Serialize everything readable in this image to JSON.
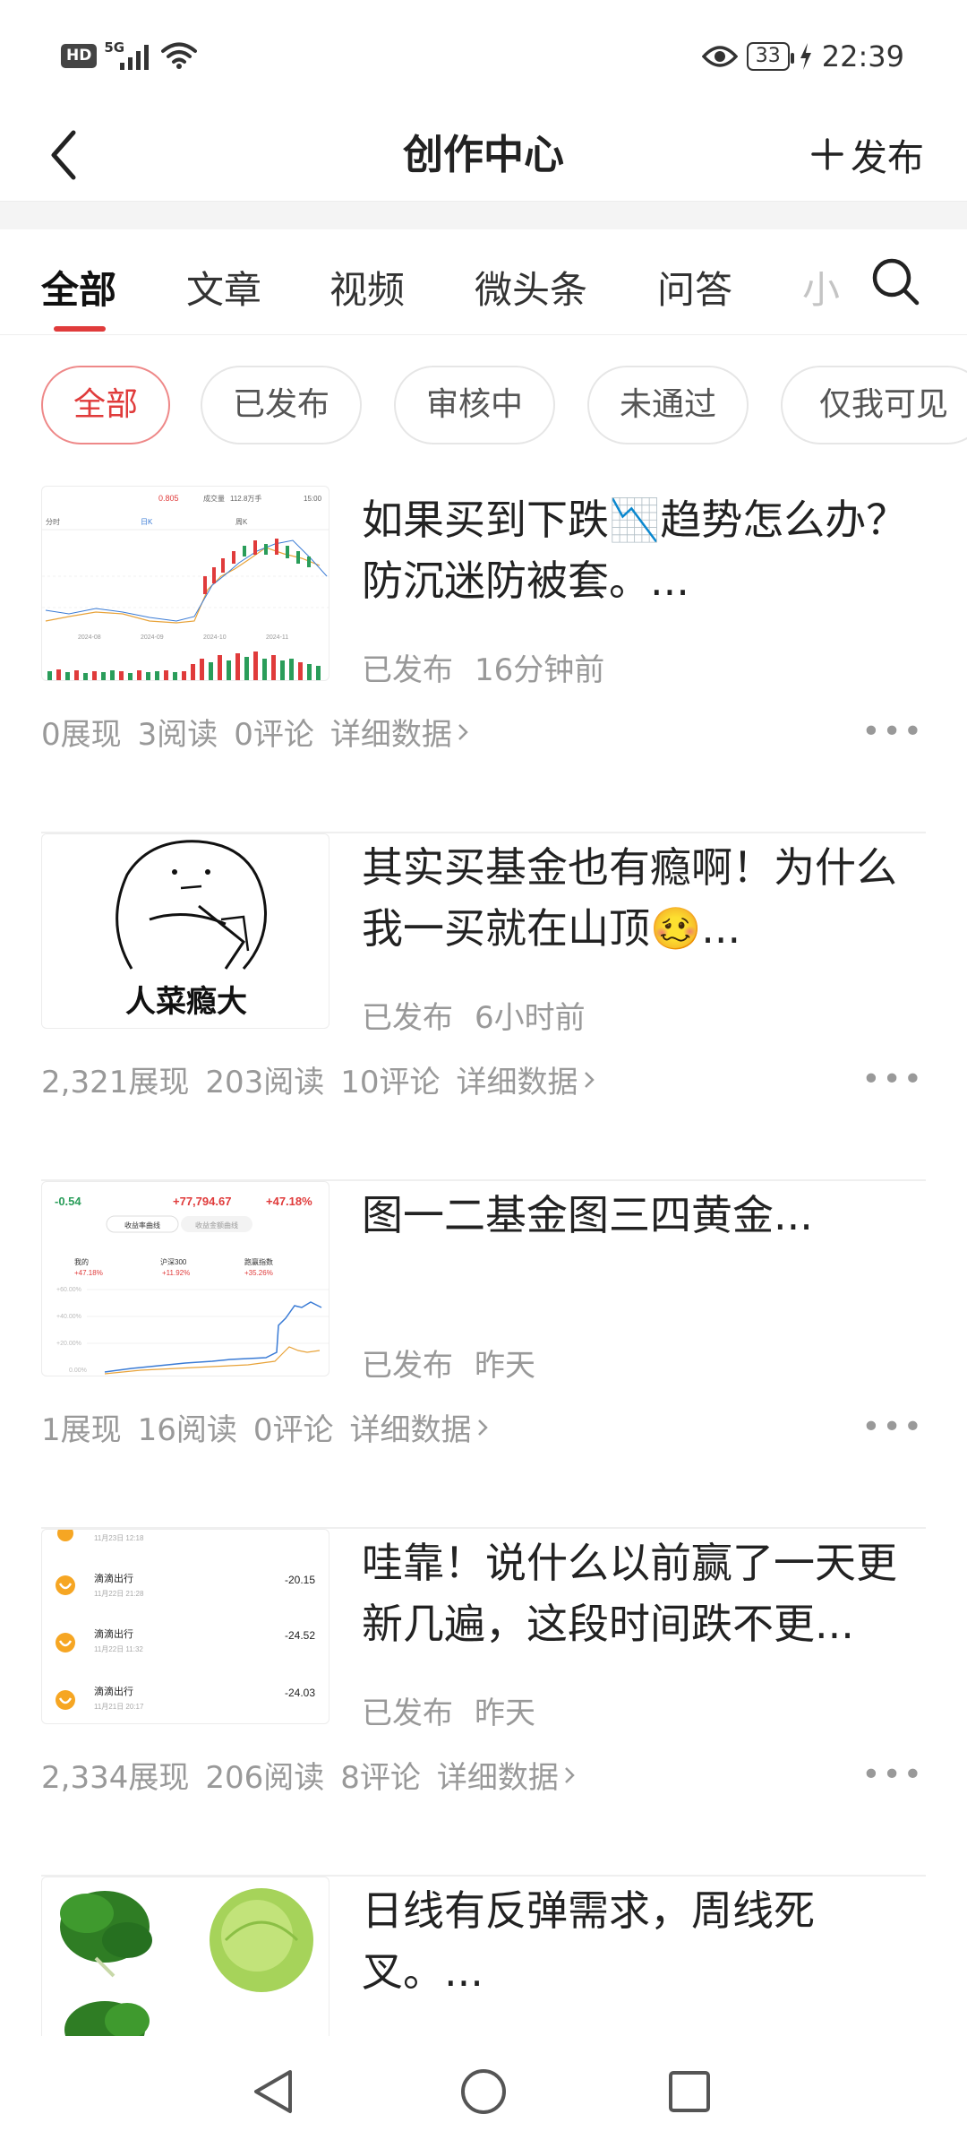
{
  "status_bar": {
    "hd": "HD",
    "network": "5G",
    "battery": "33",
    "time": "22:39"
  },
  "header": {
    "title": "创作中心",
    "publish_label": "发布"
  },
  "tabs": [
    {
      "label": "全部",
      "active": true
    },
    {
      "label": "文章"
    },
    {
      "label": "视频"
    },
    {
      "label": "微头条"
    },
    {
      "label": "问答"
    },
    {
      "label": "小"
    }
  ],
  "filters": [
    {
      "label": "全部",
      "active": true
    },
    {
      "label": "已发布"
    },
    {
      "label": "审核中"
    },
    {
      "label": "未通过"
    },
    {
      "label": "仅我可见"
    }
  ],
  "posts": [
    {
      "title": "如果买到下跌📉趋势怎么办？防沉迷防被套。...",
      "status": "已发布",
      "time": "16分钟前",
      "impressions": "0展现",
      "reads": "3阅读",
      "comments": "0评论",
      "detail": "详细数据",
      "thumb_text": {
        "price": "0.805",
        "vol_label": "成交量",
        "vol": "112.8万手",
        "time": "15:00",
        "tab1": "分时",
        "tab2": "日K",
        "tab3": "周K",
        "d1": "2024-08",
        "d2": "2024-09",
        "d3": "2024-10",
        "d4": "2024-11"
      }
    },
    {
      "title": "其实买基金也有瘾啊！为什么我一买就在山顶🥴...",
      "status": "已发布",
      "time": "6小时前",
      "impressions": "2,321展现",
      "reads": "203阅读",
      "comments": "10评论",
      "detail": "详细数据",
      "thumb_text": {
        "caption": "人菜瘾大"
      }
    },
    {
      "title": "图一二基金图三四黄金...",
      "status": "已发布",
      "time": "昨天",
      "impressions": "1展现",
      "reads": "16阅读",
      "comments": "0评论",
      "detail": "详细数据",
      "thumb_text": {
        "v1": "-0.54",
        "v2": "+77,794.67",
        "v3": "+47.18%",
        "btn1": "收益率曲线",
        "btn2": "收益金额曲线",
        "l1": "我的",
        "l1v": "+47.18%",
        "l2": "沪深300",
        "l2v": "+11.92%",
        "l3": "跑赢指数",
        "l3v": "+35.26%",
        "y1": "+60.00%",
        "y2": "+40.00%",
        "y3": "+20.00%",
        "y4": "0.00%"
      }
    },
    {
      "title": "哇靠！说什么以前赢了一天更新几遍，这段时间跌不更...",
      "status": "已发布",
      "time": "昨天",
      "impressions": "2,334展现",
      "reads": "206阅读",
      "comments": "8评论",
      "detail": "详细数据",
      "thumb_text": {
        "top_date": "11月23日 12:18",
        "rows": [
          {
            "name": "滴滴出行",
            "date": "11月22日 21:28",
            "amount": "-20.15"
          },
          {
            "name": "滴滴出行",
            "date": "11月22日 11:32",
            "amount": "-24.52"
          },
          {
            "name": "滴滴出行",
            "date": "11月21日 20:17",
            "amount": "-24.03"
          }
        ]
      }
    },
    {
      "title": "日线有反弹需求，周线死叉。...",
      "status": "",
      "time": ""
    }
  ],
  "colors": {
    "accent": "#e03b3b",
    "muted": "#999999"
  }
}
